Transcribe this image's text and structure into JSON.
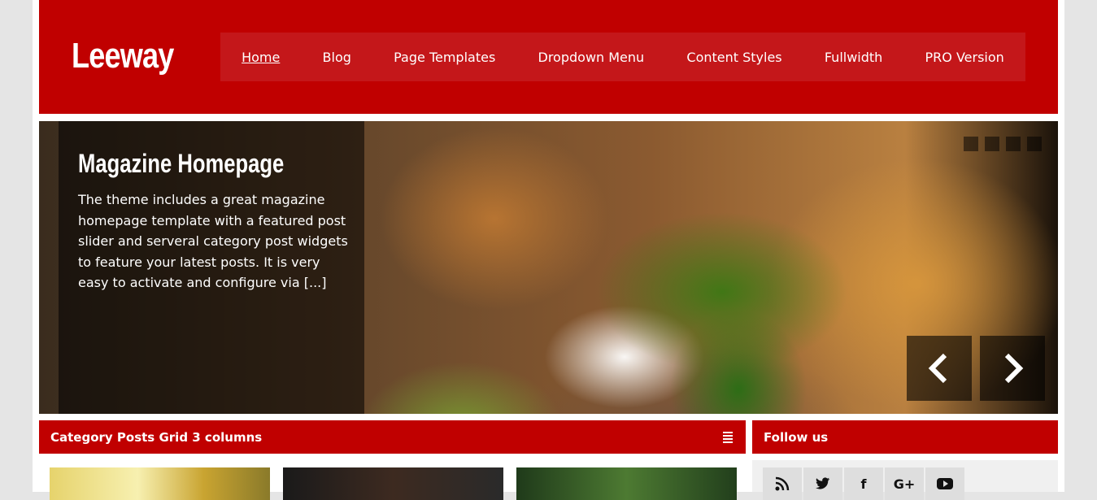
{
  "site": {
    "logo": "Leeway",
    "brand_color": "#c00000"
  },
  "nav": {
    "items": [
      {
        "label": "Home"
      },
      {
        "label": "Blog"
      },
      {
        "label": "Page Templates"
      },
      {
        "label": "Dropdown Menu"
      },
      {
        "label": "Content Styles"
      },
      {
        "label": "Fullwidth"
      },
      {
        "label": "PRO Version"
      }
    ]
  },
  "slider": {
    "title": "Magazine Homepage",
    "excerpt": "The theme includes a great magazine homepage template with a featured post slider and serveral category post widgets to feature your latest posts. It is very easy to activate and configure via [...]",
    "prev_icon": "chevron-left-icon",
    "next_icon": "chevron-right-icon"
  },
  "widgets": {
    "category_grid": {
      "title": "Category Posts Grid 3 columns",
      "icon": "grid-icon"
    },
    "follow": {
      "title": "Follow us",
      "icons": [
        "rss-icon",
        "twitter-icon",
        "facebook-icon",
        "google-plus-icon",
        "youtube-icon"
      ],
      "glyphs": {
        "rss": "⌘",
        "twitter": "🐦",
        "facebook": "f",
        "google": "G+",
        "youtube": "▶"
      }
    }
  }
}
